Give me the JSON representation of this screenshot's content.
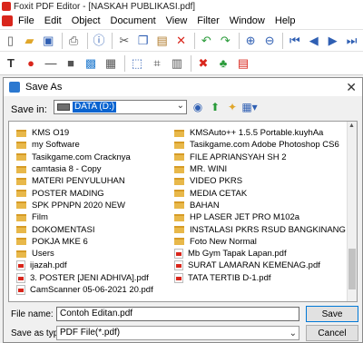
{
  "app": {
    "title": "Foxit PDF Editor - [NASKAH PUBLIKASI.pdf]"
  },
  "menu": [
    "File",
    "Edit",
    "Object",
    "Document",
    "View",
    "Filter",
    "Window",
    "Help"
  ],
  "dialog": {
    "title": "Save As",
    "save_in_label": "Save in:",
    "save_in_value": "DATA (D:)",
    "left_items": [
      {
        "name": "KMS O19",
        "type": "folder"
      },
      {
        "name": "my Software",
        "type": "folder"
      },
      {
        "name": "Tasikgame.com  Cracknya",
        "type": "folder"
      },
      {
        "name": "camtasia 8 - Copy",
        "type": "folder"
      },
      {
        "name": "MATERI PENYULUHAN",
        "type": "folder"
      },
      {
        "name": "POSTER MADING",
        "type": "folder"
      },
      {
        "name": "SPK PPNPN 2020 NEW",
        "type": "folder"
      },
      {
        "name": "Film",
        "type": "folder"
      },
      {
        "name": "DOKOMENTASI",
        "type": "folder"
      },
      {
        "name": "POKJA MKE 6",
        "type": "folder"
      },
      {
        "name": "Users",
        "type": "folder"
      },
      {
        "name": "ijazah.pdf",
        "type": "pdf"
      },
      {
        "name": "3. POSTER [JENI ADHIVA].pdf",
        "type": "pdf"
      },
      {
        "name": "CamScanner 05-06-2021 20.pdf",
        "type": "pdf"
      }
    ],
    "right_items": [
      {
        "name": "KMSAuto++ 1.5.5 Portable.kuyhAa",
        "type": "folder"
      },
      {
        "name": "Tasikgame.com  Adobe Photoshop CS6",
        "type": "folder"
      },
      {
        "name": "FILE APRIANSYAH SH 2",
        "type": "folder"
      },
      {
        "name": "MR. WINI",
        "type": "folder"
      },
      {
        "name": "VIDEO PKRS",
        "type": "folder"
      },
      {
        "name": "MEDIA CETAK",
        "type": "folder"
      },
      {
        "name": "BAHAN",
        "type": "folder"
      },
      {
        "name": "HP LASER JET PRO M102a",
        "type": "folder"
      },
      {
        "name": "INSTALASI PKRS RSUD BANGKINANG",
        "type": "folder"
      },
      {
        "name": "Foto New Normal",
        "type": "folder"
      },
      {
        "name": "Mb Gym Tapak Lapan.pdf",
        "type": "pdf"
      },
      {
        "name": "SURAT LAMARAN KEMENAG.pdf",
        "type": "pdf"
      },
      {
        "name": "TATA TERTIB D-1.pdf",
        "type": "pdf"
      }
    ],
    "file_name_label": "File name:",
    "file_name_value": "Contoh Editan.pdf",
    "save_as_type_label": "Save as type:",
    "save_as_type_value": "PDF File(*.pdf)",
    "save_button": "Save",
    "cancel_button": "Cancel"
  }
}
